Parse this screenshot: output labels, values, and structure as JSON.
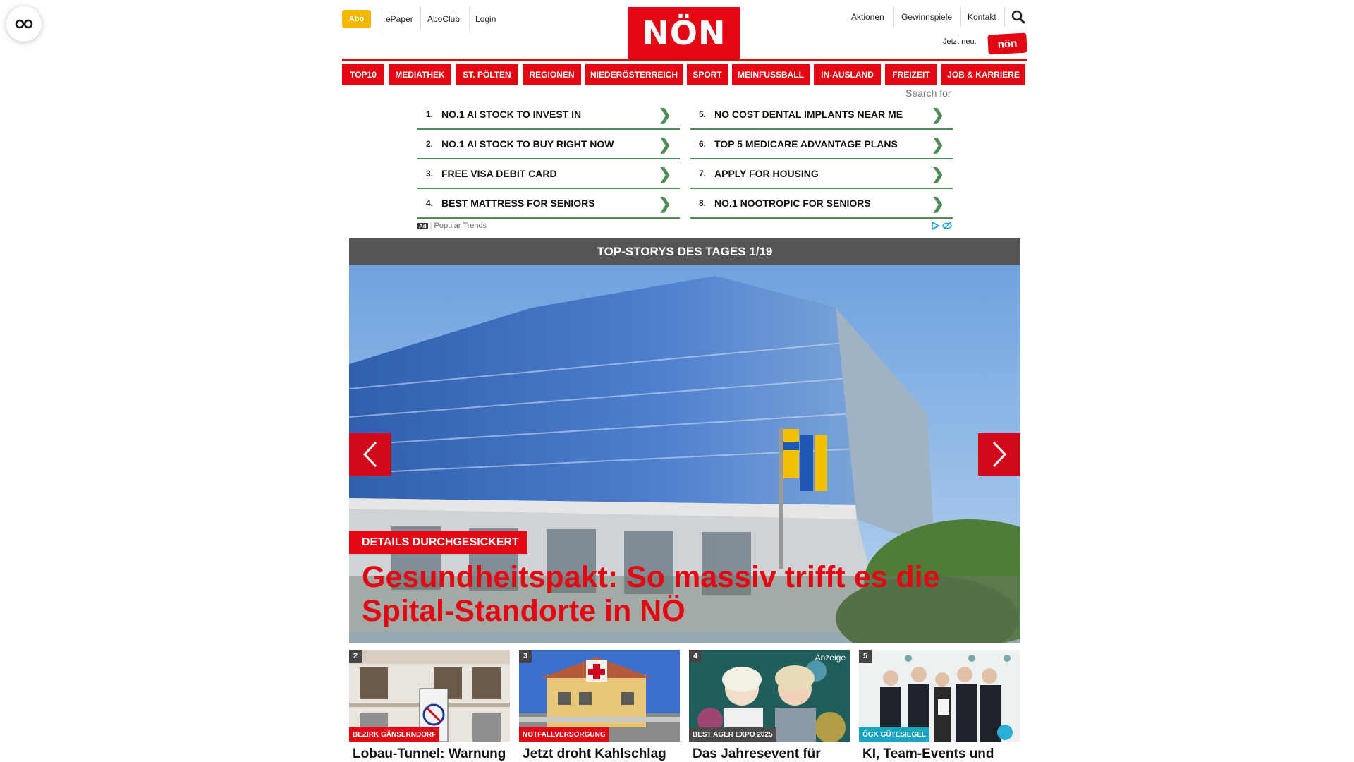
{
  "top_bar": {
    "abo": "Abo",
    "epaper": "ePaper",
    "aboclub": "AboClub",
    "login": "Login",
    "logo": "NÖN",
    "aktionen": "Aktionen",
    "gewinnspiele": "Gewinnspiele",
    "kontakt": "Kontakt",
    "jetzt_neu": "Jetzt neu:",
    "neu_badge": "nön"
  },
  "nav": [
    "TOP10",
    "MEDIATHEK",
    "ST. PÖLTEN",
    "REGIONEN",
    "NIEDERÖSTERREICH",
    "SPORT",
    "MEINFUSSBALL",
    "IN-AUSLAND",
    "FREIZEIT",
    "JOB & KARRIERE"
  ],
  "ad": {
    "search_for": "Search for",
    "left": [
      {
        "num": "1.",
        "text": "NO.1 AI STOCK TO INVEST IN"
      },
      {
        "num": "2.",
        "text": "NO.1 AI STOCK TO BUY RIGHT NOW"
      },
      {
        "num": "3.",
        "text": "FREE VISA DEBIT CARD"
      },
      {
        "num": "4.",
        "text": "BEST MATTRESS FOR SENIORS"
      }
    ],
    "right": [
      {
        "num": "5.",
        "text": "NO COST DENTAL IMPLANTS NEAR ME"
      },
      {
        "num": "6.",
        "text": "TOP 5 MEDICARE ADVANTAGE PLANS"
      },
      {
        "num": "7.",
        "text": "APPLY FOR HOUSING"
      },
      {
        "num": "8.",
        "text": "NO.1 NOOTROPIC FOR SENIORS"
      }
    ],
    "ad_tag": "Ad",
    "source": "Popular Trends"
  },
  "top_stories": {
    "header": "TOP-STORYS DES TAGES 1/19",
    "hero_kicker": "DETAILS DURCHGESICKERT",
    "hero_title": "Gesundheitspakt: So massiv trifft es die Spital-Standorte in NÖ"
  },
  "teasers": [
    {
      "num": "2",
      "kicker": "BEZIRK GÄNSERNDORF",
      "title": "Lobau-Tunnel: Warnung vor \"türkis-rot-pinkem"
    },
    {
      "num": "3",
      "kicker": "NOTFALLVERSORGUNG",
      "title": "Jetzt droht Kahlschlag bei Notarzt-Standorten"
    },
    {
      "num": "4",
      "kicker": "BEST AGER EXPO 2025",
      "anzeige": "Anzeige",
      "title": "Das Jahresevent für aktive Senioren und"
    },
    {
      "num": "5",
      "kicker": "ÖGK GÜTESIEGEL",
      "title": "KI, Team-Events und Obst: Was Unternehmen"
    }
  ],
  "colors": {
    "brand_red": "#e30613",
    "ad_green": "#4f8d57",
    "abo_yellow": "#f5b800"
  }
}
